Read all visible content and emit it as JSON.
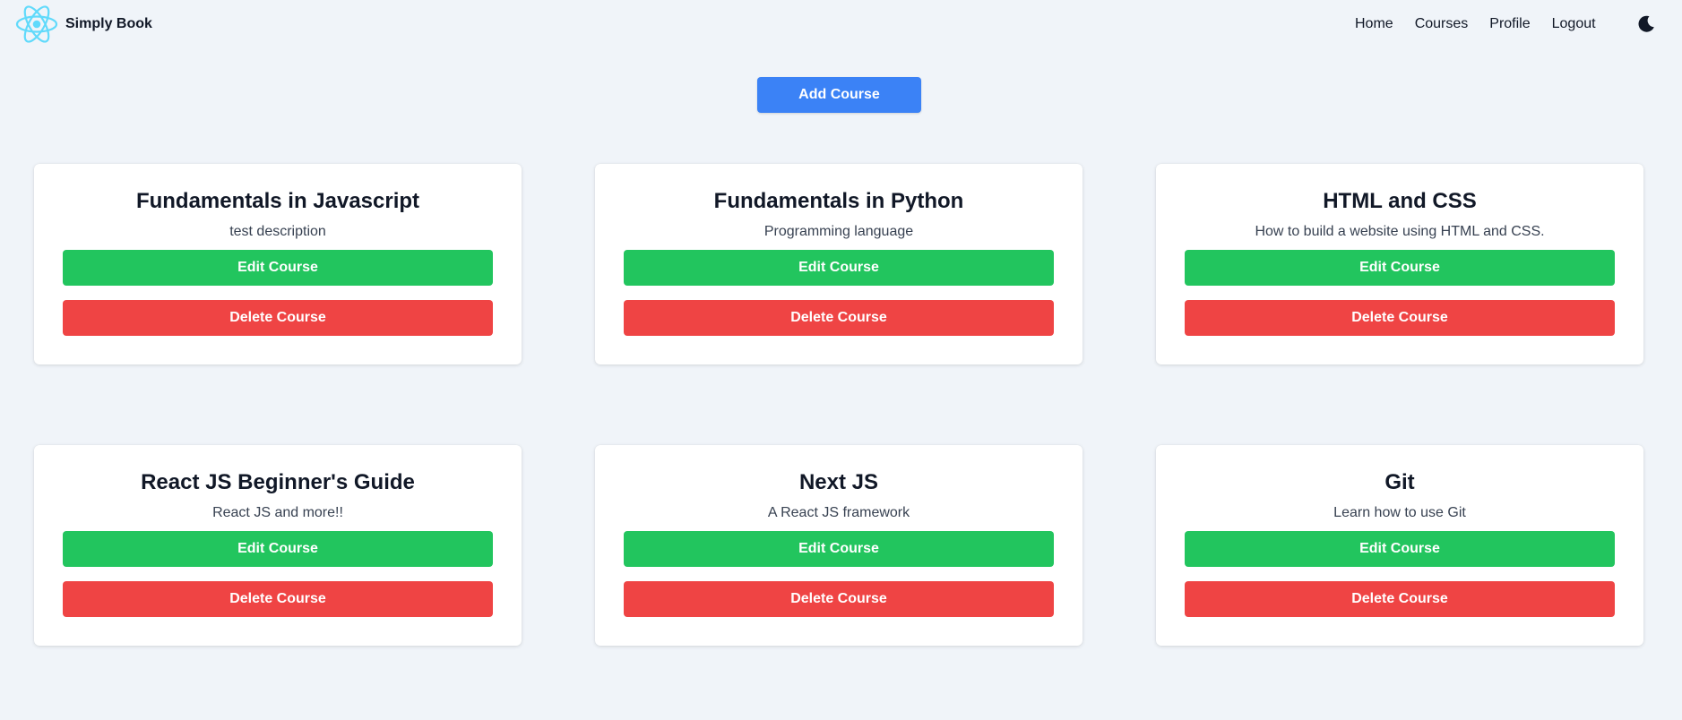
{
  "navbar": {
    "brand_name": "Simply Book",
    "links": [
      "Home",
      "Courses",
      "Profile",
      "Logout"
    ],
    "theme_icon": "moon-icon",
    "logo_icon": "react-logo-icon"
  },
  "add_course_label": "Add Course",
  "courses": [
    {
      "title": "Fundamentals in Javascript",
      "description": "test description",
      "edit_label": "Edit Course",
      "delete_label": "Delete Course"
    },
    {
      "title": "Fundamentals in Python",
      "description": "Programming language",
      "edit_label": "Edit Course",
      "delete_label": "Delete Course"
    },
    {
      "title": "HTML and CSS",
      "description": "How to build a website using HTML and CSS.",
      "edit_label": "Edit Course",
      "delete_label": "Delete Course"
    },
    {
      "title": "React JS Beginner's Guide",
      "description": "React JS and more!!",
      "edit_label": "Edit Course",
      "delete_label": "Delete Course"
    },
    {
      "title": "Next JS",
      "description": "A React JS framework",
      "edit_label": "Edit Course",
      "delete_label": "Delete Course"
    },
    {
      "title": "Git",
      "description": "Learn how to use Git",
      "edit_label": "Edit Course",
      "delete_label": "Delete Course"
    }
  ],
  "colors": {
    "background": "#f0f4f9",
    "primary": "#3b82f6",
    "edit": "#22c55e",
    "delete": "#ef4444",
    "logo": "#61dafb"
  }
}
